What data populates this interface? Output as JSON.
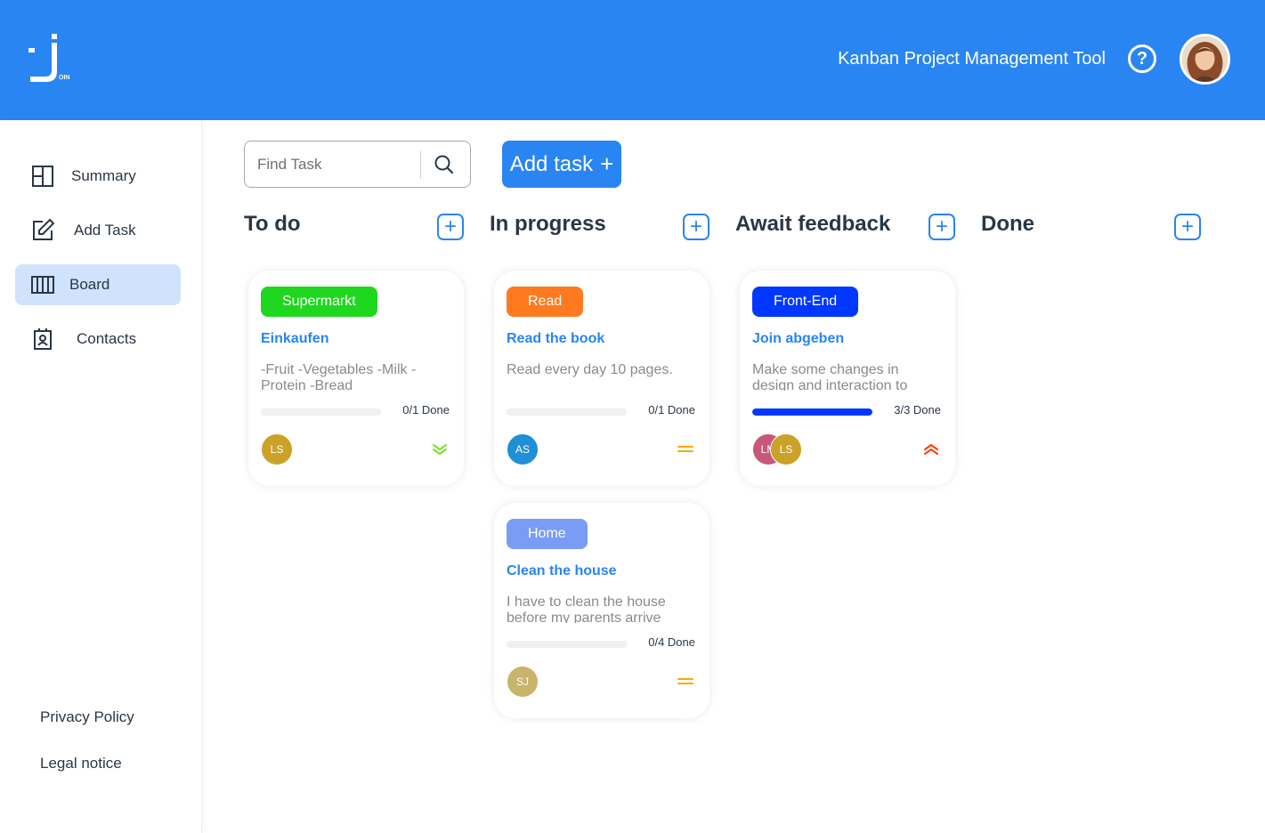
{
  "header": {
    "app_title": "Kanban Project Management Tool",
    "help_symbol": "?",
    "logo_text": "OIN"
  },
  "sidebar": {
    "items": [
      {
        "label": "Summary",
        "icon": "summary-icon"
      },
      {
        "label": "Add Task",
        "icon": "edit-icon"
      },
      {
        "label": "Board",
        "icon": "board-icon",
        "active": true
      },
      {
        "label": "Contacts",
        "icon": "contacts-icon"
      }
    ],
    "footer": {
      "privacy": "Privacy Policy",
      "legal": "Legal notice"
    }
  },
  "toolbar": {
    "search_placeholder": "Find Task",
    "add_task_label": "Add task",
    "add_task_symbol": "+"
  },
  "columns": [
    {
      "title": "To do"
    },
    {
      "title": "In progress"
    },
    {
      "title": "Await feedback"
    },
    {
      "title": "Done"
    }
  ],
  "cards": [
    {
      "column": "To do",
      "label": "Supermarkt",
      "label_color": "#1fd71f",
      "title": "Einkaufen",
      "description": "-Fruit -Vegetables -Milk -Protein -Bread",
      "subtasks_done": 0,
      "subtasks_total": 1,
      "progress_text": "0/1 Done",
      "assignees": [
        {
          "initials": "LS",
          "color": "#c9a227"
        }
      ],
      "priority": "low"
    },
    {
      "column": "In progress",
      "label": "Read",
      "label_color": "#ff7a1f",
      "title": "Read the book",
      "description": "Read every day 10 pages.",
      "subtasks_done": 0,
      "subtasks_total": 1,
      "progress_text": "0/1 Done",
      "assignees": [
        {
          "initials": "AS",
          "color": "#1f8fd6"
        }
      ],
      "priority": "medium"
    },
    {
      "column": "In progress",
      "label": "Home",
      "label_color": "#7a9cf5",
      "title": "Clean the house",
      "description": "I have to clean the house before my parents arrive",
      "subtasks_done": 0,
      "subtasks_total": 4,
      "progress_text": "0/4 Done",
      "assignees": [
        {
          "initials": "SJ",
          "color": "#c8b46a"
        }
      ],
      "priority": "medium"
    },
    {
      "column": "Await feedback",
      "label": "Front-End",
      "label_color": "#0038ff",
      "title": "Join abgeben",
      "description": "Make some changes in design and interaction to",
      "subtasks_done": 3,
      "subtasks_total": 3,
      "progress_text": "3/3 Done",
      "assignees": [
        {
          "initials": "LM",
          "color": "#c9577a"
        },
        {
          "initials": "LS",
          "color": "#c9a227"
        }
      ],
      "priority": "urgent"
    }
  ],
  "colors": {
    "brand": "#2985f2",
    "nav_active": "#cfe3fc",
    "text_dark": "#2a3647",
    "progress_fill": "#0038ff",
    "prio_low": "#7ae229",
    "prio_medium": "#ffa800",
    "prio_urgent": "#ff3d00"
  }
}
